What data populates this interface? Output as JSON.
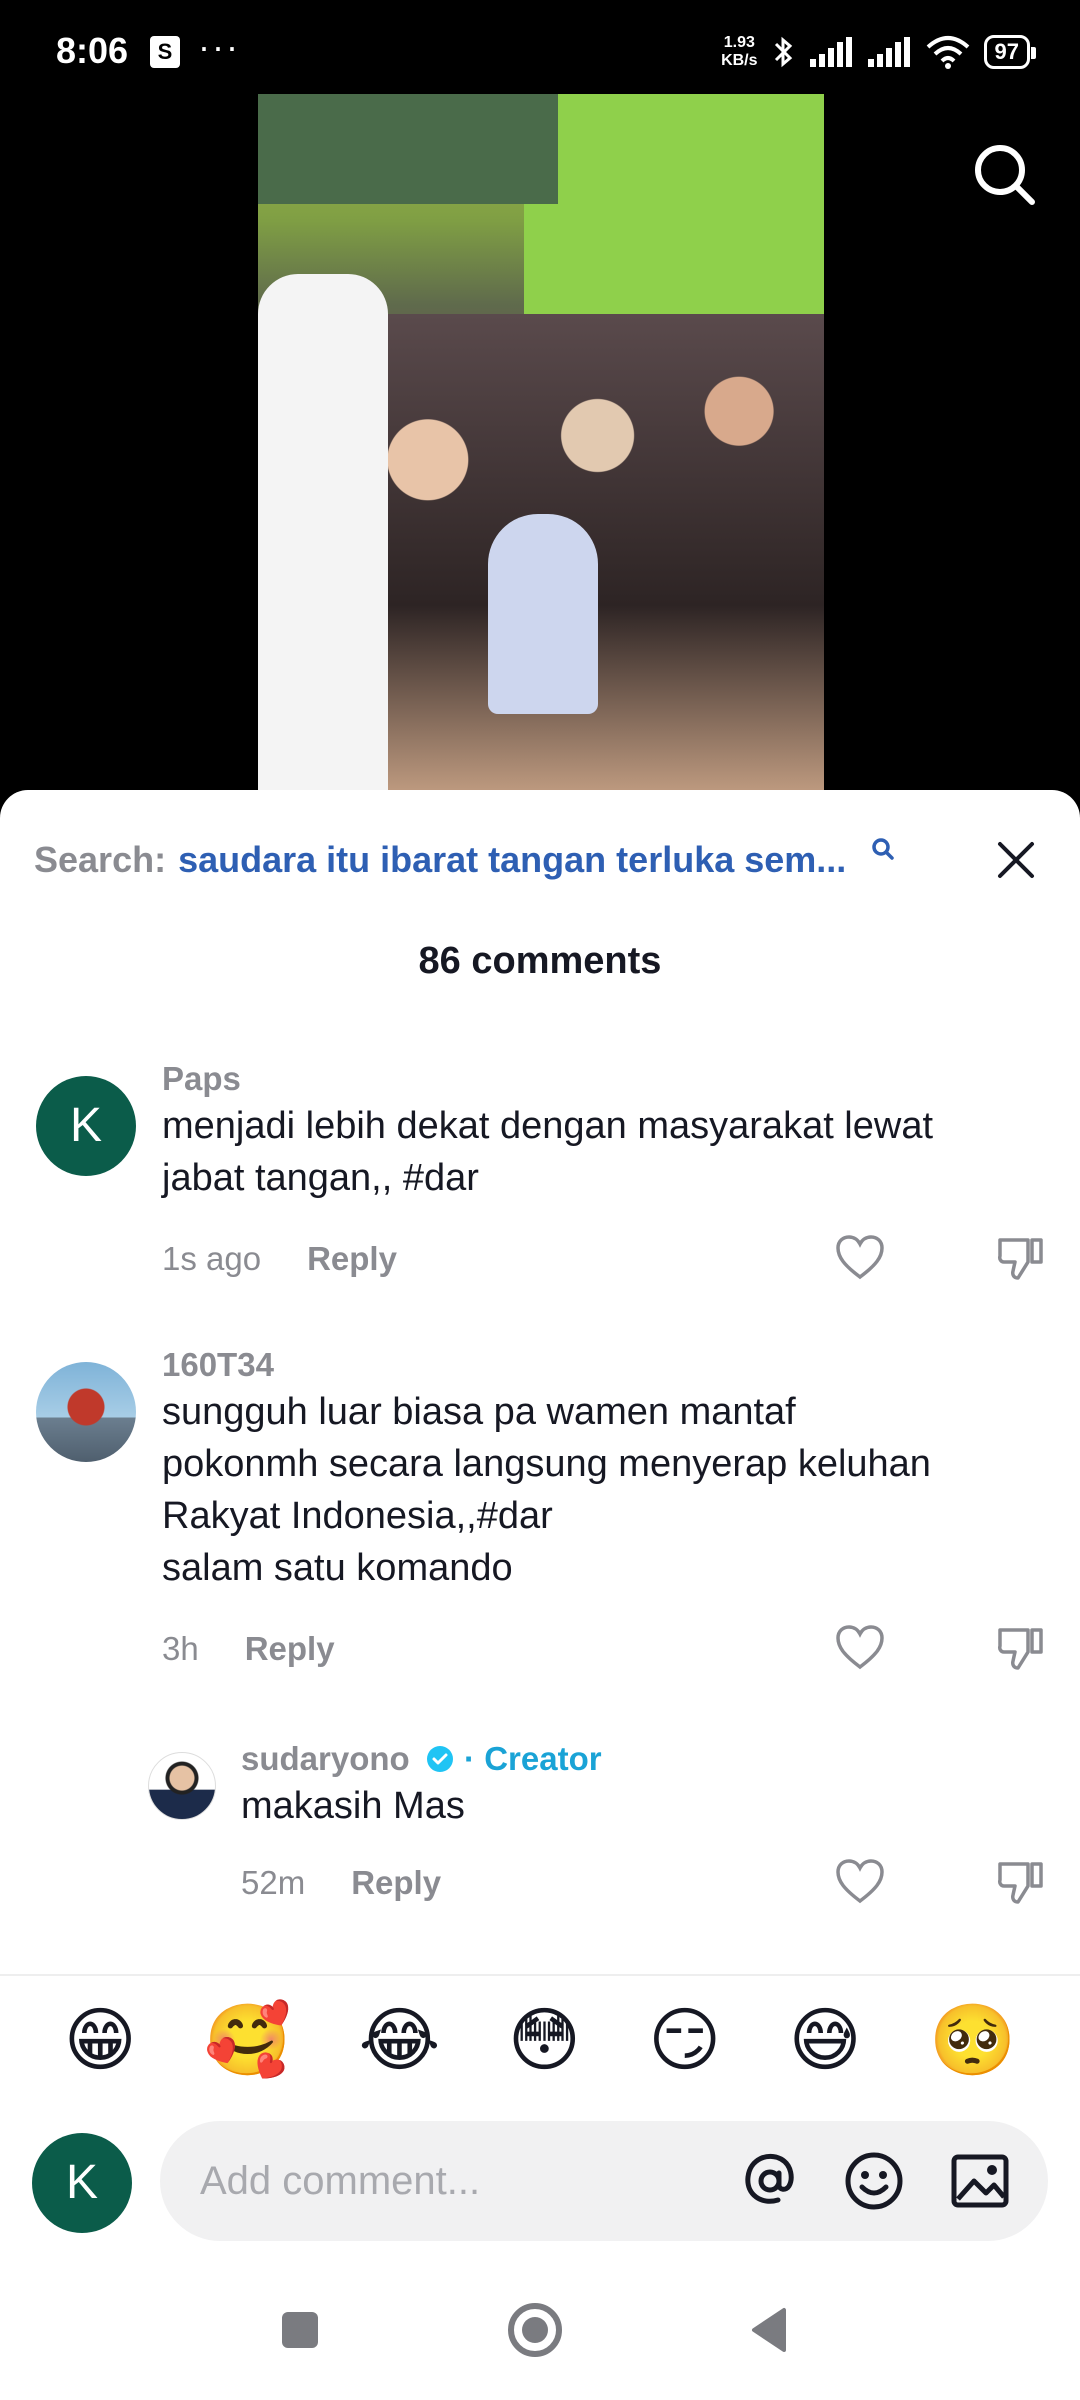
{
  "status_bar": {
    "time": "8:06",
    "net_speed_value": "1.93",
    "net_speed_unit": "KB/s",
    "battery": "97"
  },
  "sheet": {
    "search_prefix": "Search:",
    "search_query": "saudara itu ibarat tangan terluka sem...",
    "comment_count": "86 comments"
  },
  "comments": [
    {
      "avatar_letter": "K",
      "username": "Paps",
      "text_lines": [
        "menjadi lebih dekat dengan masyarakat lewat",
        "jabat tangan,, #dar"
      ],
      "time": "1s ago",
      "reply": "Reply"
    },
    {
      "username": "160T34",
      "text_lines": [
        "sungguh luar biasa pa wamen mantaf",
        "pokonmh secara langsung menyerap keluhan",
        "Rakyat Indonesia,,#dar",
        "salam satu komando"
      ],
      "time": "3h",
      "reply": "Reply"
    },
    {
      "username": "sudaryono",
      "creator_label": "· Creator",
      "text": "makasih Mas",
      "time": "52m",
      "reply": "Reply"
    }
  ],
  "emojis": [
    "😁",
    "🥰",
    "😂",
    "😳",
    "😏",
    "😅",
    "🥺"
  ],
  "input": {
    "avatar_letter": "K",
    "placeholder": "Add comment..."
  },
  "icons": {
    "search": "search-icon",
    "close": "close-icon",
    "like": "heart-icon",
    "dislike": "thumbs-down-icon",
    "mention": "at-icon",
    "emoji": "smiley-icon",
    "image": "image-icon"
  },
  "colors": {
    "accent_blue": "#2e5fb3",
    "creator_blue": "#1aa3d6",
    "avatar_green": "#0b5c4a",
    "muted_text": "#8a8b91"
  }
}
